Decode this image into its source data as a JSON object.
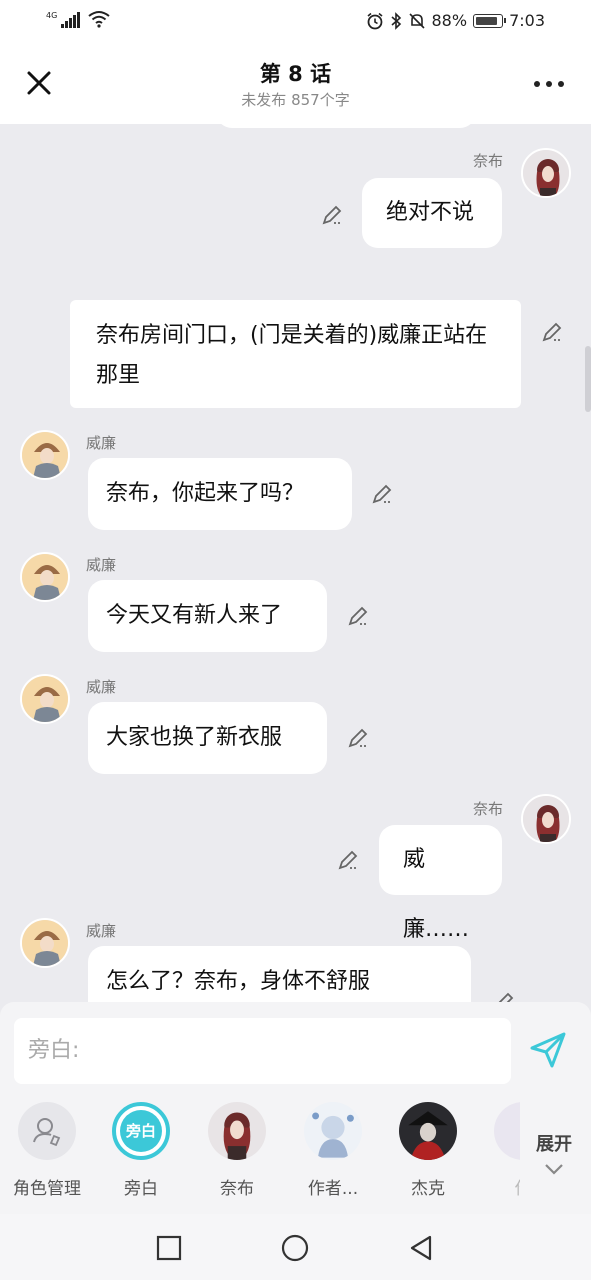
{
  "status": {
    "network": "4G",
    "battery": "88%",
    "time": "7:03"
  },
  "header": {
    "title": "第 8 话",
    "subtitle": "未发布 857个字"
  },
  "messages": [
    {
      "speaker": "奈布",
      "text": "绝对不说",
      "side": "right"
    },
    {
      "speaker": "",
      "text": "奈布房间门口，(门是关着的)威廉正站在那里",
      "side": "narration"
    },
    {
      "speaker": "威廉",
      "text": "奈布，你起来了吗？",
      "side": "left"
    },
    {
      "speaker": "威廉",
      "text": "今天又有新人来了",
      "side": "left"
    },
    {
      "speaker": "威廉",
      "text": "大家也换了新衣服",
      "side": "left"
    },
    {
      "speaker": "奈布",
      "text": "威廉……",
      "side": "right"
    },
    {
      "speaker": "威廉",
      "text": "怎么了？奈布，身体不舒服",
      "side": "left"
    }
  ],
  "composer": {
    "placeholder": "旁白:"
  },
  "roles": [
    {
      "label": "角色管理",
      "icon": "user-edit-icon"
    },
    {
      "label": "旁白",
      "badge": "旁白"
    },
    {
      "label": "奈布"
    },
    {
      "label": "作者..."
    },
    {
      "label": "杰克"
    },
    {
      "label": "作"
    }
  ],
  "expand_label": "展开",
  "colors": {
    "accent": "#3cc8d8",
    "chat_bg": "#ebebef",
    "bubble_bg": "#ffffff"
  }
}
